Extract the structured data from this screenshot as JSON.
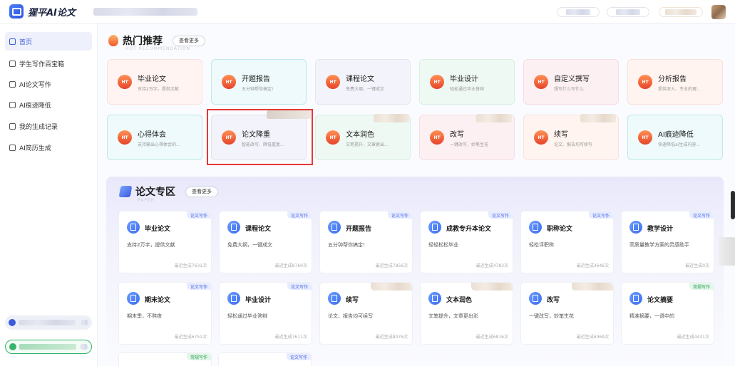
{
  "app": {
    "name": "猩平AI论文"
  },
  "sidebar": {
    "items": [
      {
        "label": "首页",
        "icon": "home-icon"
      },
      {
        "label": "学生写作百宝箱",
        "icon": "toolbox-icon"
      },
      {
        "label": "AI论文写作",
        "icon": "document-icon"
      },
      {
        "label": "AI痕迹降低",
        "icon": "scan-icon"
      },
      {
        "label": "我的生成记录",
        "icon": "history-icon"
      },
      {
        "label": "AI简历生成",
        "icon": "resume-icon"
      }
    ]
  },
  "hot": {
    "title": "热门推荐",
    "subtitle": "HOT RECOMMENDATION",
    "more": "查看更多",
    "items": [
      {
        "title": "毕业论文",
        "desc": "支持2万字，提供文献"
      },
      {
        "title": "开题报告",
        "desc": "五分钟帮你搞定!"
      },
      {
        "title": "课程论文",
        "desc": "免费大纲，一键成文"
      },
      {
        "title": "毕业设计",
        "desc": "轻松通过毕业答辩"
      },
      {
        "title": "自定义撰写",
        "desc": "想写什么写什么"
      },
      {
        "title": "分析报告",
        "desc": "提供深入、专业的理..."
      },
      {
        "title": "心得体会",
        "desc": "支持输出心得体会的..."
      },
      {
        "title": "论文降重",
        "desc": "智能改写、降低重复..."
      },
      {
        "title": "文本润色",
        "desc": "文笔提升，文章更出..."
      },
      {
        "title": "改写",
        "desc": "一键改写，妙笔生花"
      },
      {
        "title": "续写",
        "desc": "论文、报告均可续写"
      },
      {
        "title": "AI痕迹降低",
        "desc": "快速降低ai生成内容..."
      }
    ],
    "icon_text": "HT"
  },
  "paper": {
    "title": "论文专区",
    "subtitle": "PAPER",
    "more": "查看更多",
    "items": [
      {
        "title": "毕业论文",
        "desc": "支持2万字，提供文献",
        "tag": "论文写作",
        "count": "最近生成7631次"
      },
      {
        "title": "课程论文",
        "desc": "免费大纲，一键成文",
        "tag": "论文写作",
        "count": "最近生成8760次"
      },
      {
        "title": "开题报告",
        "desc": "五分钟帮你搞定!",
        "tag": "论文写作",
        "count": "最近生成7856次"
      },
      {
        "title": "成教专升本论文",
        "desc": "轻轻松松毕业",
        "tag": "论文写作",
        "count": "最近生成4783次"
      },
      {
        "title": "职称论文",
        "desc": "轻松评职称",
        "tag": "论文写作",
        "count": "最近生成3646次"
      },
      {
        "title": "教学设计",
        "desc": "高质量教学方案的灵感助手",
        "tag": "论文写作",
        "count": "最近生成0次"
      },
      {
        "title": "期末论文",
        "desc": "期末季，不熬夜",
        "tag": "论文写作",
        "count": "最近生成6751次"
      },
      {
        "title": "毕业设计",
        "desc": "轻松通过毕业答辩",
        "tag": "论文写作",
        "count": "最近生成7611次"
      },
      {
        "title": "续写",
        "desc": "论文、报告均可续写",
        "tag": "",
        "count": "最近生成8076次"
      },
      {
        "title": "文本润色",
        "desc": "文笔提升，文章更出彩",
        "tag": "",
        "count": "最近生成6816次"
      },
      {
        "title": "改写",
        "desc": "一键改写，妙笔生花",
        "tag": "",
        "count": "最近生成6969次"
      },
      {
        "title": "论文摘要",
        "desc": "精准摘要，一语中的",
        "tag": "常规写作",
        "count": "最近生成4431次"
      }
    ],
    "partial_tags": [
      "常规写作",
      "论文写作"
    ]
  },
  "colors": {
    "accent": "#3b5bdb",
    "highlight": "#e53935"
  }
}
